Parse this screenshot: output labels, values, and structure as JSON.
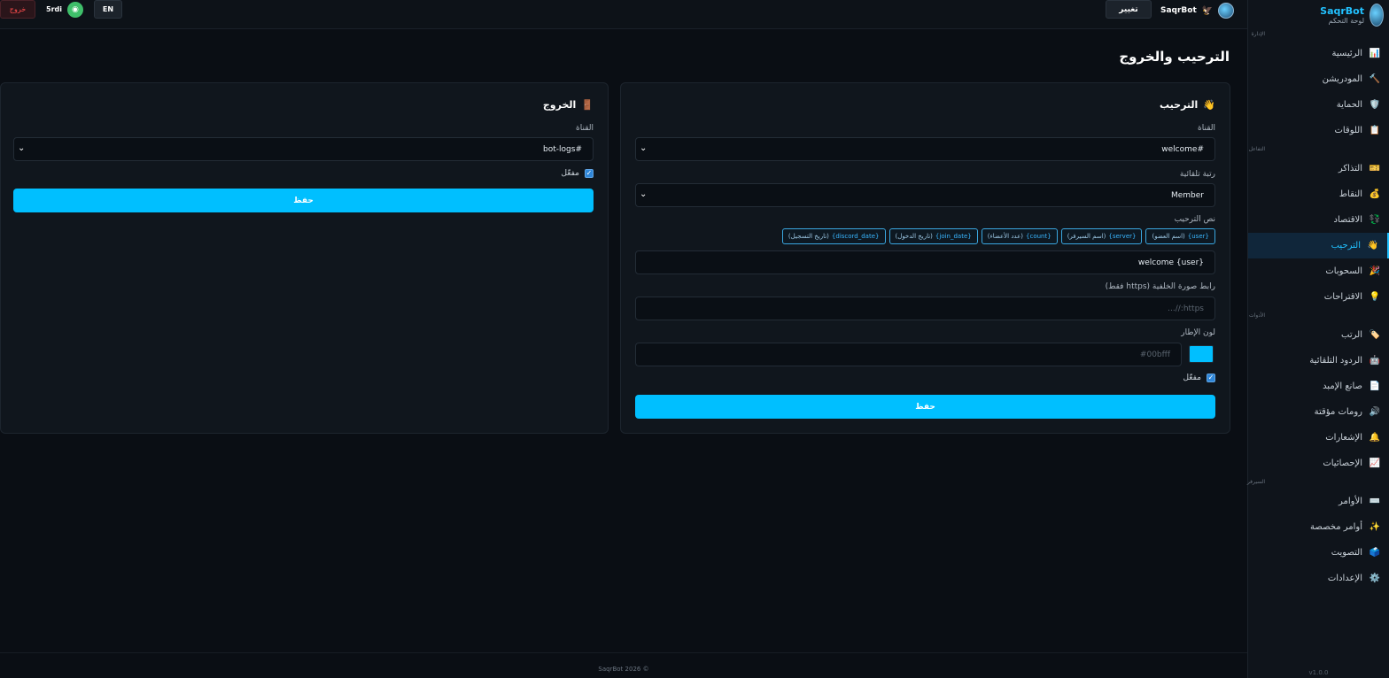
{
  "brand": {
    "name": "SaqrBot",
    "subtitle": "لوحة التحكم"
  },
  "sidebar": {
    "sections": [
      {
        "title": "الإدارة",
        "items": [
          {
            "icon": "📊",
            "label": "الرئيسية"
          },
          {
            "icon": "🔨",
            "label": "المودريشن"
          },
          {
            "icon": "🛡️",
            "label": "الحماية"
          },
          {
            "icon": "📋",
            "label": "اللوقات"
          }
        ]
      },
      {
        "title": "التفاعل",
        "items": [
          {
            "icon": "🎫",
            "label": "التذاكر"
          },
          {
            "icon": "💰",
            "label": "النقاط"
          },
          {
            "icon": "💱",
            "label": "الاقتصاد"
          },
          {
            "icon": "👋",
            "label": "الترحيب",
            "active": true
          },
          {
            "icon": "🎉",
            "label": "السحوبات"
          },
          {
            "icon": "💡",
            "label": "الاقتراحات"
          }
        ]
      },
      {
        "title": "الأدوات",
        "items": [
          {
            "icon": "🏷️",
            "label": "الرتب"
          },
          {
            "icon": "🤖",
            "label": "الردود التلقائية"
          },
          {
            "icon": "📄",
            "label": "صانع الإمبد"
          },
          {
            "icon": "🔊",
            "label": "رومات مؤقتة"
          },
          {
            "icon": "🔔",
            "label": "الإشعارات"
          },
          {
            "icon": "📈",
            "label": "الإحصائيات"
          }
        ]
      },
      {
        "title": "السيرفر",
        "items": [
          {
            "icon": "⌨️",
            "label": "الأوامر"
          },
          {
            "icon": "✨",
            "label": "أوامر مخصصة"
          },
          {
            "icon": "🗳️",
            "label": "التصويت"
          },
          {
            "icon": "⚙️",
            "label": "الإعدادات"
          }
        ]
      }
    ],
    "version": "v1.0.0"
  },
  "topbar": {
    "logout": "خروج",
    "username": "5rdi",
    "lang": "EN",
    "change": "تغيير",
    "bot_name": "SaqrBot"
  },
  "page": {
    "title": "الترحيب والخروج"
  },
  "welcome": {
    "title": "الترحيب",
    "icon": "👋",
    "channel_label": "القناة",
    "channel_value": "#welcome",
    "role_label": "رتبة تلقائية",
    "role_value": "Member",
    "text_label": "نص الترحيب",
    "chips": [
      {
        "var": "{user}",
        "desc": "(اسم العضو)"
      },
      {
        "var": "{server}",
        "desc": "(اسم السيرفر)"
      },
      {
        "var": "{count}",
        "desc": "(عدد الأعضاء)"
      },
      {
        "var": "{join_date}",
        "desc": "(تاريخ الدخول)"
      },
      {
        "var": "{discord_date}",
        "desc": "(تاريخ التسجيل)"
      }
    ],
    "text_value": "welcome {user}",
    "bg_label": "رابط صورة الخلفية (https فقط)",
    "bg_placeholder": "https://...",
    "color_label": "لون الإطار",
    "color_value": "#00bfff",
    "enabled_label": "مفعّل",
    "save": "حفظ"
  },
  "leave": {
    "title": "الخروج",
    "icon": "🚪",
    "channel_label": "القناة",
    "channel_value": "#bot-logs",
    "enabled_label": "مفعّل",
    "save": "حفظ"
  },
  "footer": "SaqrBot 2026 ©"
}
